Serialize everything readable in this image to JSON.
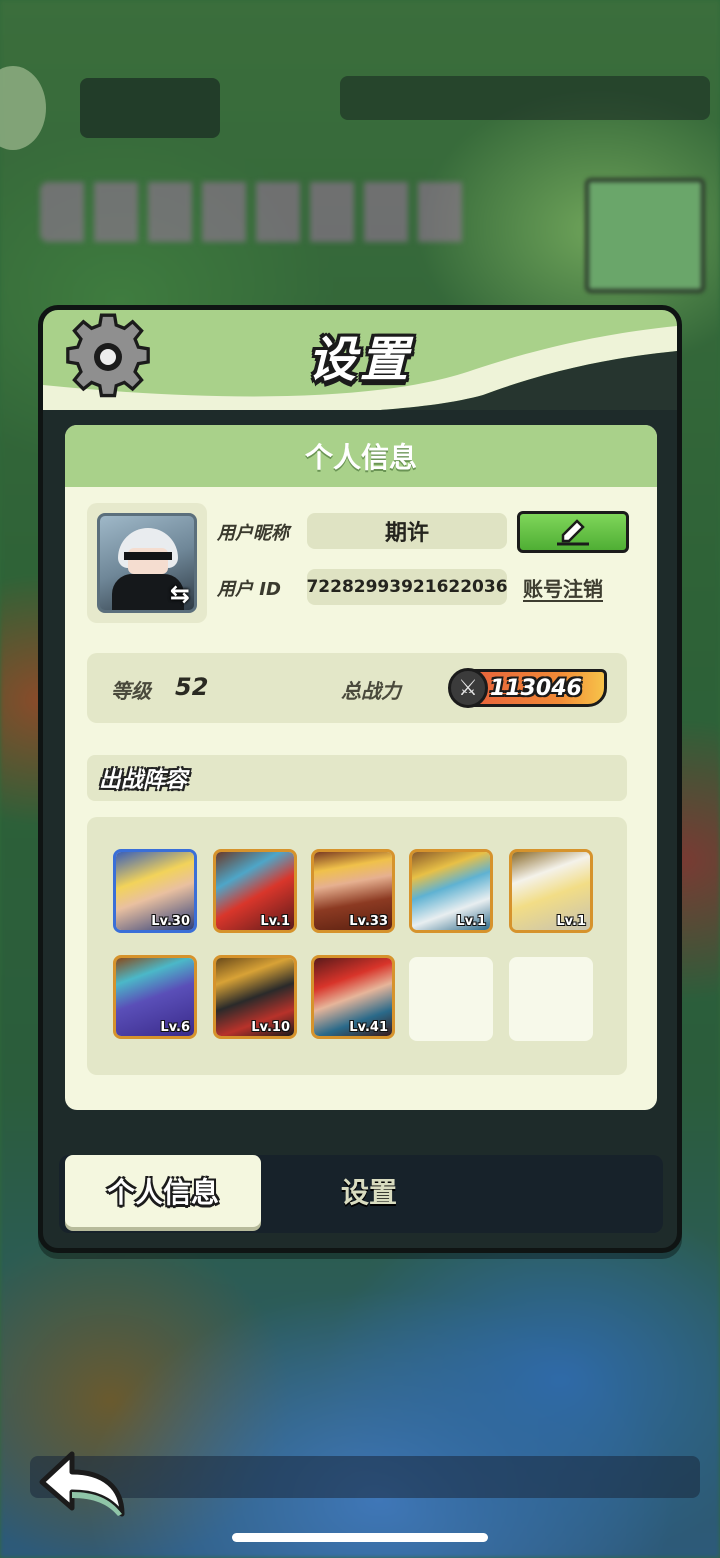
{
  "panel": {
    "title": "设置",
    "section_title": "个人信息"
  },
  "profile": {
    "nickname_label": "用户昵称",
    "nickname": "期许",
    "id_label": "用户 ID",
    "user_id": "72282993921622036",
    "cancel_account": "账号注销",
    "avatar_swap_icon": "⇆"
  },
  "stats": {
    "level_label": "等级",
    "level": "52",
    "power_label": "总战力",
    "power": "113046"
  },
  "lineup": {
    "title": "出战阵容",
    "heroes": [
      {
        "level": "Lv.30"
      },
      {
        "level": "Lv.1"
      },
      {
        "level": "Lv.33"
      },
      {
        "level": "Lv.1"
      },
      {
        "level": "Lv.1"
      },
      {
        "level": "Lv.6"
      },
      {
        "level": "Lv.10"
      },
      {
        "level": "Lv.41"
      }
    ],
    "empty_slots": 2
  },
  "tabs": [
    {
      "label": "个人信息",
      "active": true
    },
    {
      "label": "设置",
      "active": false
    }
  ],
  "icons": {
    "settings": "gear-icon",
    "edit": "pencil-icon",
    "back": "back-arrow-icon",
    "power": "crossed-swords-icon"
  },
  "colors": {
    "header_green": "#a9d18a",
    "card_bg": "#f4f7df",
    "edit_button": "#5fc03f",
    "hero_frame_gold": "#d6932c",
    "hero_frame_blue": "#3a6fd8"
  }
}
